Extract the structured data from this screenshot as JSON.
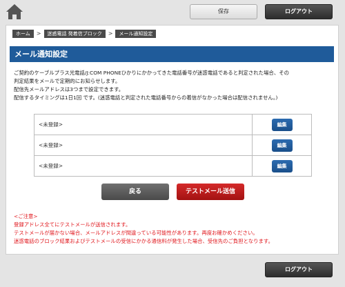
{
  "header": {
    "home_icon": "home-icon",
    "save_label": "保存",
    "logout_label": "ログアウト"
  },
  "breadcrumb": {
    "items": [
      "ホーム",
      "迷惑電話 発着信ブロック",
      "メール通知設定"
    ],
    "separator": ">"
  },
  "page": {
    "title": "メール通知設定",
    "description": [
      "ご契約のケーブルプラス光電話/J:COM PHONEひかりにかかってきた電話番号が迷惑電話であると判定された場合、その",
      "判定結果をメールで定期的にお知らせします。",
      "配信先メールアドレスは3つまで設定できます。",
      "配信するタイミングは1日1回 です。(迷惑電話と判定された電話番号からの着信がなかった場合は配信されません。)"
    ]
  },
  "addresses": [
    {
      "label": "<未登録>",
      "edit_label": "編集"
    },
    {
      "label": "<未登録>",
      "edit_label": "編集"
    },
    {
      "label": "<未登録>",
      "edit_label": "編集"
    }
  ],
  "actions": {
    "back_label": "戻る",
    "test_mail_label": "テストメール送信"
  },
  "notes": {
    "heading": "<ご注意>",
    "lines": [
      "登録アドレス全てにテストメールが送信されます。",
      "テストメールが届かない場合、メールアドレスが間違っている可能性があります。再度お確かめください。",
      "迷惑電話のブロック結果およびテストメールの受信にかかる通信料が発生した場合、受信先のご負担となります。"
    ]
  },
  "footer": {
    "logout_label": "ログアウト"
  },
  "colors": {
    "title_bar": "#1f5b9a",
    "edit_button": "#1a4f8a",
    "test_button": "#c01d1d",
    "notes_text": "#e0151b"
  }
}
